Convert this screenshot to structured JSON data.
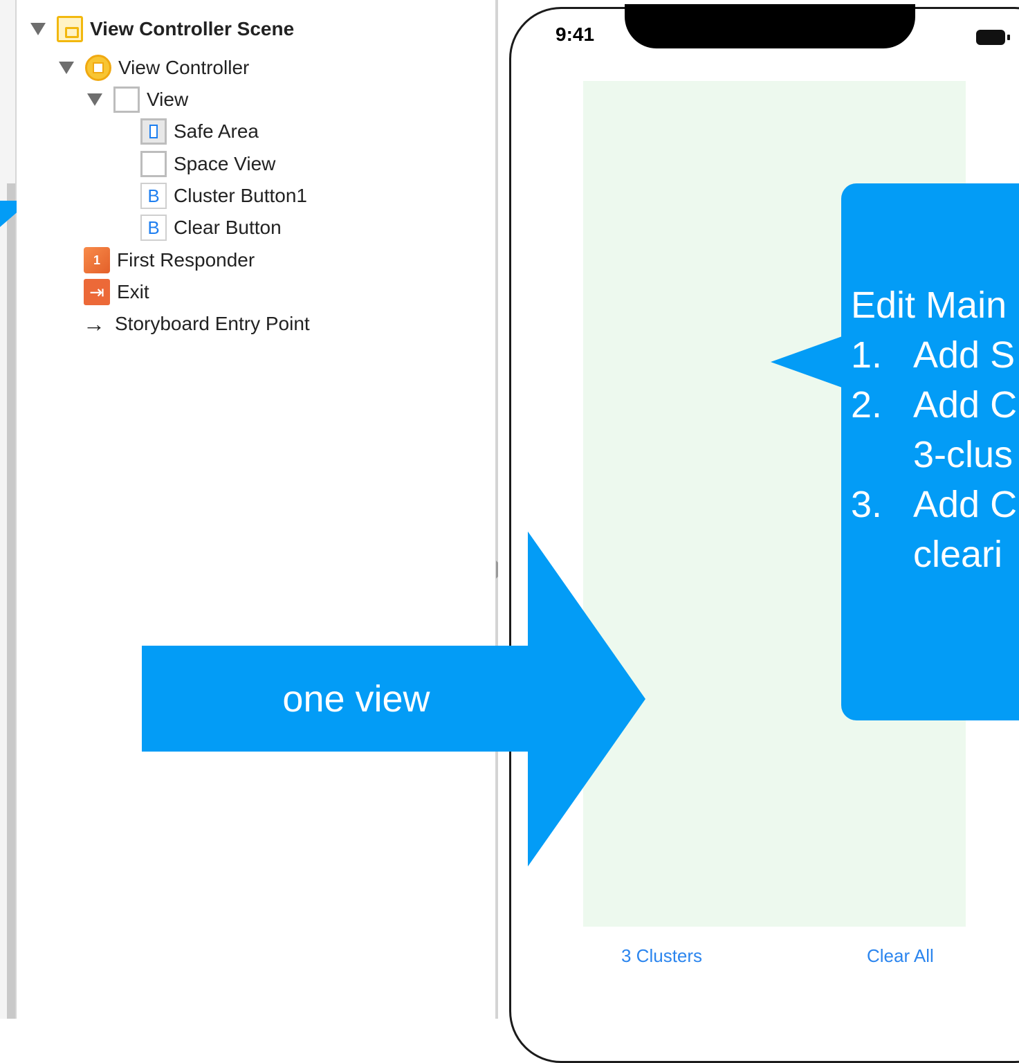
{
  "outline": {
    "items": [
      {
        "label": "View Controller Scene"
      },
      {
        "label": "View Controller"
      },
      {
        "label": "View"
      },
      {
        "label": "Safe Area"
      },
      {
        "label": "Space View"
      },
      {
        "label": "Cluster Button1",
        "icon_letter": "B"
      },
      {
        "label": "Clear Button",
        "icon_letter": "B"
      },
      {
        "label": "First Responder",
        "icon_text": "1"
      },
      {
        "label": "Exit",
        "icon_text": "⇥"
      },
      {
        "label": "Storyboard Entry Point",
        "icon_text": "→"
      }
    ]
  },
  "device": {
    "time": "9:41",
    "buttons": {
      "left": "3 Clusters",
      "right": "Clear All"
    }
  },
  "callouts": {
    "arrow_label": "one view",
    "bubble_lines": [
      {
        "num": "",
        "text": "Edit Main"
      },
      {
        "num": "1.",
        "text": "Add S"
      },
      {
        "num": "2.",
        "text": "Add C"
      },
      {
        "num": "",
        "text": "3-clus"
      },
      {
        "num": "3.",
        "text": "Add C"
      },
      {
        "num": "",
        "text": "cleari"
      }
    ]
  },
  "colors": {
    "callout_blue": "#039cf6",
    "space_view_bg": "#edf9ee",
    "link_blue": "#2b85ee"
  }
}
